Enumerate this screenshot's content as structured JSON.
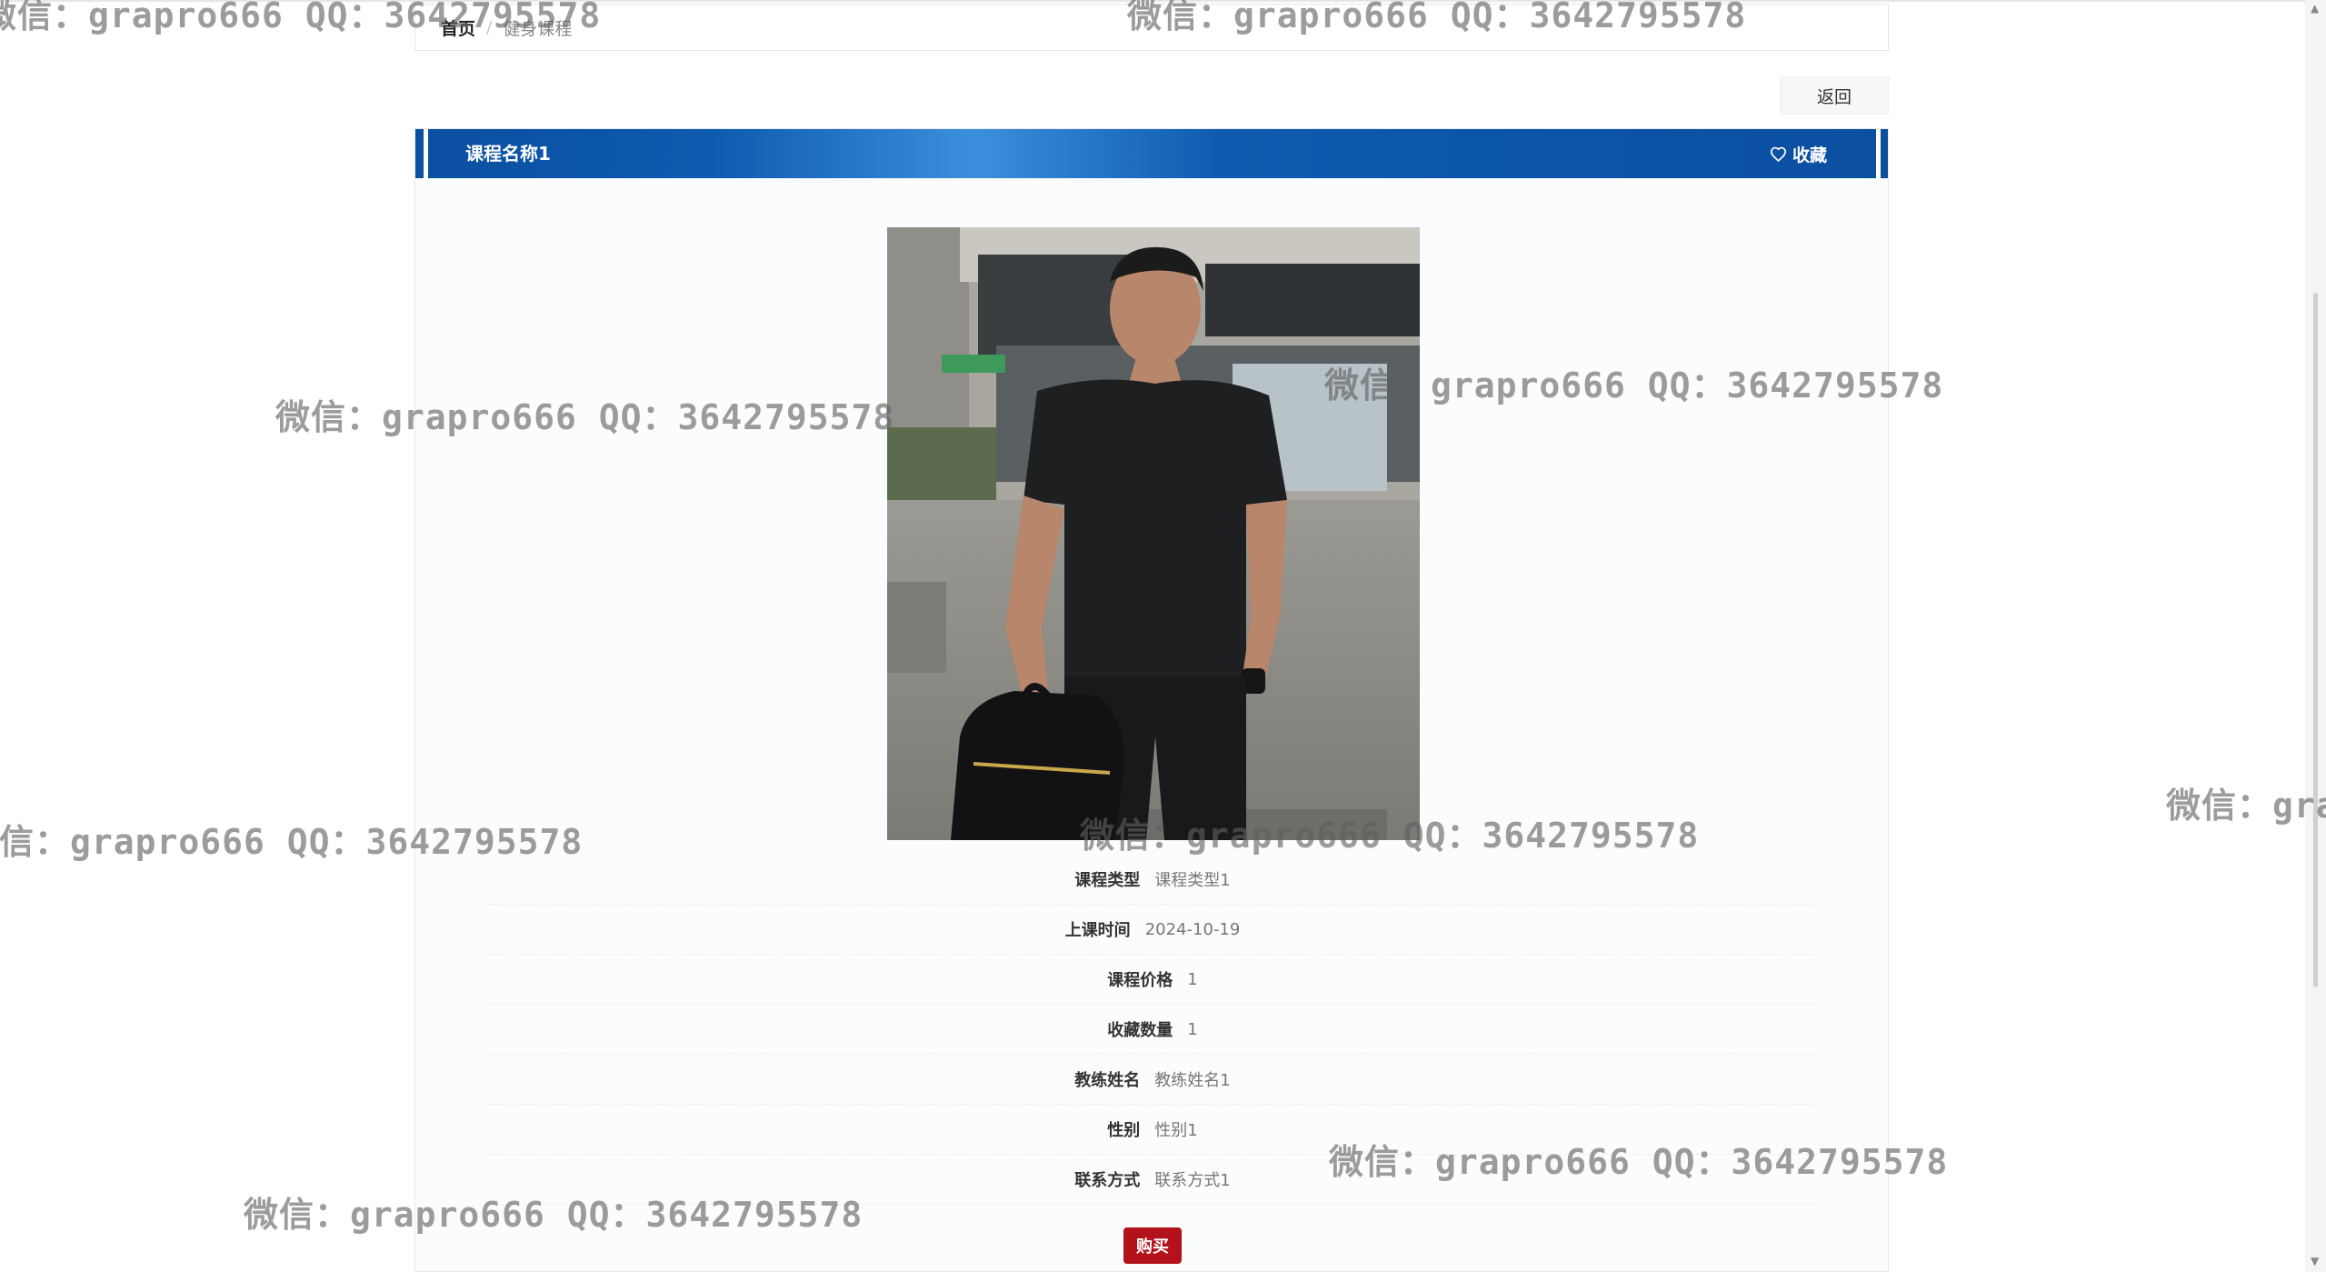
{
  "breadcrumb": {
    "home": "首页",
    "separator": "/",
    "current": "健身课程"
  },
  "back_button": "返回",
  "course": {
    "title": "课程名称1",
    "favorite_label": "收藏"
  },
  "details": [
    {
      "label": "课程类型",
      "value": "课程类型1"
    },
    {
      "label": "上课时间",
      "value": "2024-10-19"
    },
    {
      "label": "课程价格",
      "value": "1"
    },
    {
      "label": "收藏数量",
      "value": "1"
    },
    {
      "label": "教练姓名",
      "value": "教练姓名1"
    },
    {
      "label": "性别",
      "value": "性别1"
    },
    {
      "label": "联系方式",
      "value": "联系方式1"
    }
  ],
  "buy_button": "购买",
  "watermark": "微信：grapro666 QQ：3642795578",
  "colors": {
    "title_bar": "#0b4fa0",
    "buy_button": "#b3121b"
  },
  "icons": {
    "favorite": "heart-icon"
  }
}
